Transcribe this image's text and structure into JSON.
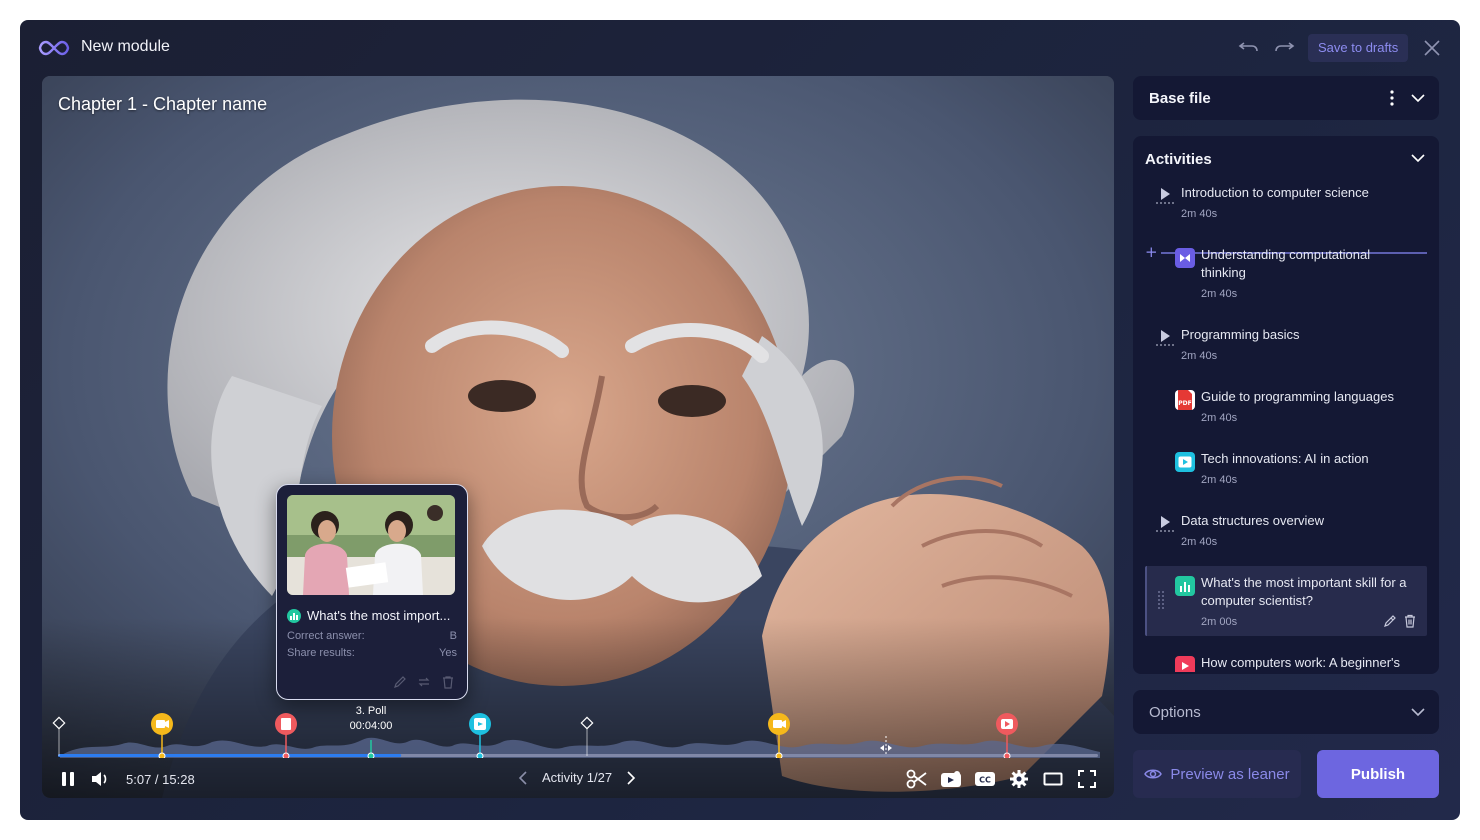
{
  "header": {
    "title": "New module",
    "save_drafts_label": "Save to drafts"
  },
  "video": {
    "chapter_title": "Chapter 1 - Chapter name",
    "current_time": "5:07",
    "duration": "15:28",
    "time_display": "5:07 / 15:28",
    "progress_fraction": 0.33,
    "activity_counter": "Activity 1/27"
  },
  "popup": {
    "title": "What's the most import...",
    "correct_answer_label": "Correct answer:",
    "correct_answer_value": "B",
    "share_results_label": "Share results:",
    "share_results_value": "Yes"
  },
  "timeline_marker": {
    "label": "3. Poll",
    "time": "00:04:00"
  },
  "base_file": {
    "title": "Base file"
  },
  "activities": {
    "title": "Activities",
    "items": [
      {
        "name": "Introduction to computer science",
        "duration": "2m 40s",
        "type": "video-section"
      },
      {
        "name": "Understanding computational thinking",
        "duration": "2m 40s",
        "type": "interactive"
      },
      {
        "name": "Programming basics",
        "duration": "2m 40s",
        "type": "video-section"
      },
      {
        "name": "Guide to programming languages",
        "duration": "2m 40s",
        "type": "pdf"
      },
      {
        "name": "Tech innovations: AI in action",
        "duration": "2m 40s",
        "type": "video"
      },
      {
        "name": "Data structures overview",
        "duration": "2m 40s",
        "type": "video-section"
      },
      {
        "name": "What's the most important skill for a computer scientist?",
        "duration": "2m 00s",
        "type": "poll"
      },
      {
        "name": "How computers work: A beginner's",
        "duration": "",
        "type": "youtube"
      }
    ]
  },
  "options": {
    "title": "Options"
  },
  "footer": {
    "preview_label": "Preview as leaner",
    "publish_label": "Publish"
  },
  "colors": {
    "accent": "#6d66e0",
    "marker_yellow": "#f5b81b",
    "marker_red": "#ef5a5e",
    "marker_cyan": "#1ec0e0",
    "poll_green": "#22c7a0",
    "youtube_red": "#f03b5a",
    "interactive_purple": "#6a5de4",
    "pdf_red": "#e53935",
    "panel": "#141834"
  }
}
